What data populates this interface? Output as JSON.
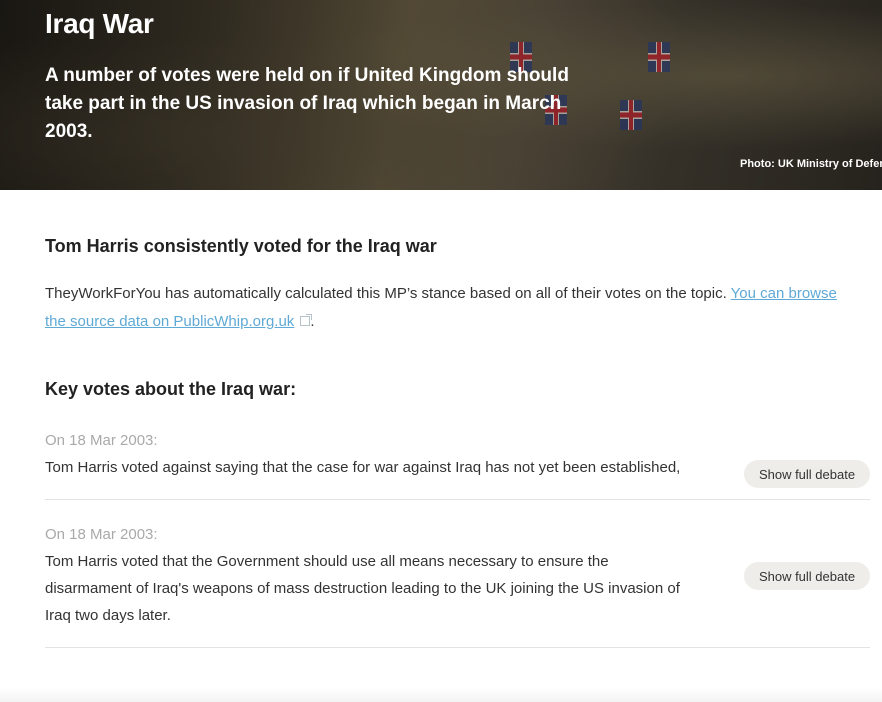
{
  "hero": {
    "title": "Iraq War",
    "description": "A number of votes were held on if United Kingdom should take part in the US invasion of Iraq which began in March 2003.",
    "photo_credit": "Photo: UK Ministry of Defence"
  },
  "stance": {
    "prefix": "Tom Harris consistently voted for the ",
    "topic": "Iraq war"
  },
  "explanation": {
    "text": "TheyWorkForYou has automatically calculated this MP’s stance based on all of their votes on the topic. ",
    "link_text": "You can browse the source data on PublicWhip.org.uk",
    "suffix": "."
  },
  "key_votes": {
    "heading_prefix": "Key votes about the ",
    "heading_topic": "Iraq war",
    "heading_suffix": ":",
    "items": [
      {
        "date": "On 18 Mar 2003:",
        "text": "Tom Harris voted against saying that the case for war against Iraq has not yet been established,",
        "button_label": "Show full debate"
      },
      {
        "date": "On 18 Mar 2003:",
        "text": "Tom Harris voted that the Government should use all means necessary to ensure the disarmament of Iraq's weapons of mass destruction leading to the UK joining the US invasion of Iraq two days later.",
        "button_label": "Show full debate"
      }
    ]
  },
  "colors": {
    "link": "#5fa9d6",
    "date_grey": "#a9a9a9",
    "button_bg": "#eeede9"
  }
}
